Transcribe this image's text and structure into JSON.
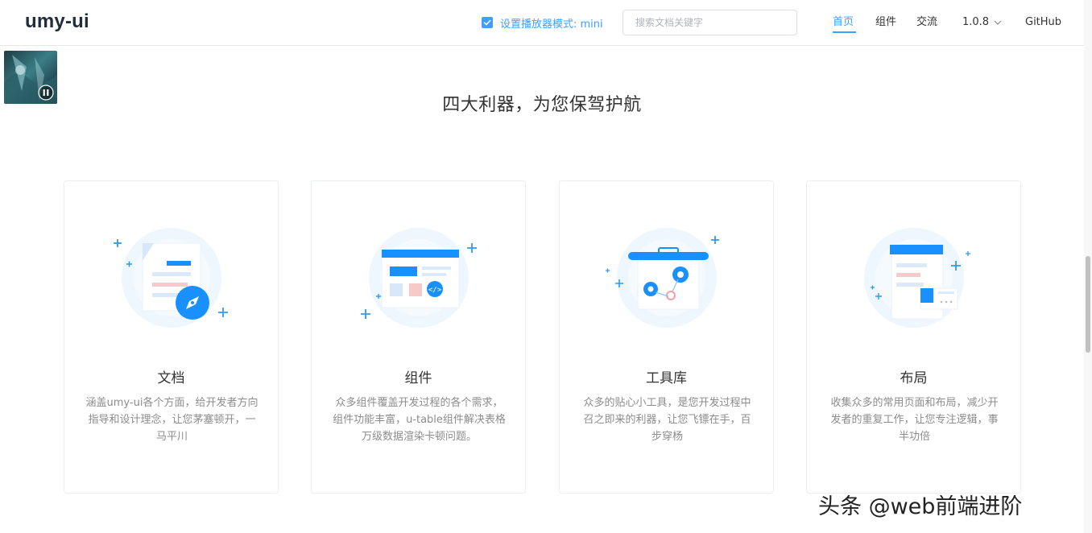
{
  "header": {
    "logo": "umy-ui",
    "player_mode_label": "设置播放器模式: mini",
    "player_mode_checked": true,
    "search_placeholder": "搜索文档关键字",
    "nav": {
      "home": "首页",
      "components": "组件",
      "community": "交流",
      "version": "1.0.8",
      "github": "GitHub"
    },
    "active_nav": "home"
  },
  "player": {
    "state": "paused",
    "icon": "pause-icon"
  },
  "section": {
    "title": "四大利器，为您保驾护航"
  },
  "cards": [
    {
      "title": "文档",
      "desc": "涵盖umy-ui各个方面，给开发者方向指导和设计理念，让您茅塞顿开，一马平川",
      "icon": "document-compass-icon"
    },
    {
      "title": "组件",
      "desc": "众多组件覆盖开发过程的各个需求，组件功能丰富，u-table组件解决表格万级数据渲染卡顿问题。",
      "icon": "component-window-icon"
    },
    {
      "title": "工具库",
      "desc": "众多的贴心小工具，是您开发过程中召之即来的利器，让您飞镖在手，百步穿杨",
      "icon": "toolbox-gears-icon"
    },
    {
      "title": "布局",
      "desc": "收集众多的常用页面和布局，减少开发者的重复工作，让您专注逻辑，事半功倍",
      "icon": "layout-page-icon"
    }
  ],
  "watermark": "头条 @web前端进阶",
  "colors": {
    "accent": "#409eff",
    "text": "#333333",
    "muted": "#8c8c8c",
    "illus_light": "#e8f4ff",
    "illus_pink": "#f7caca"
  }
}
